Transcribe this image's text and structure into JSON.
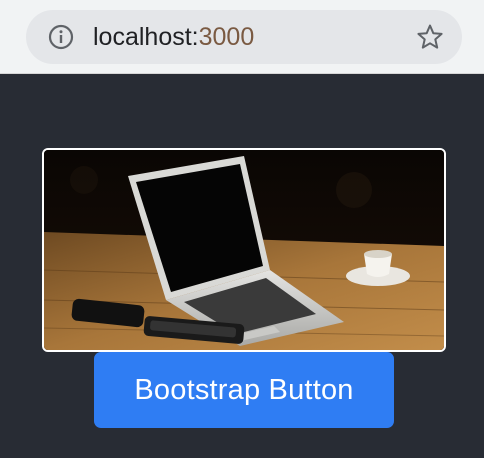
{
  "browser": {
    "url_host": "localhost:",
    "url_port": "3000",
    "info_icon": "info-icon",
    "bookmark_icon": "star-icon"
  },
  "main": {
    "image_subject": "laptop-on-wooden-table",
    "button_label": "Bootstrap Button"
  },
  "colors": {
    "page_background": "#282c34",
    "button_primary": "#2f7df3",
    "image_border": "#ffffff"
  }
}
